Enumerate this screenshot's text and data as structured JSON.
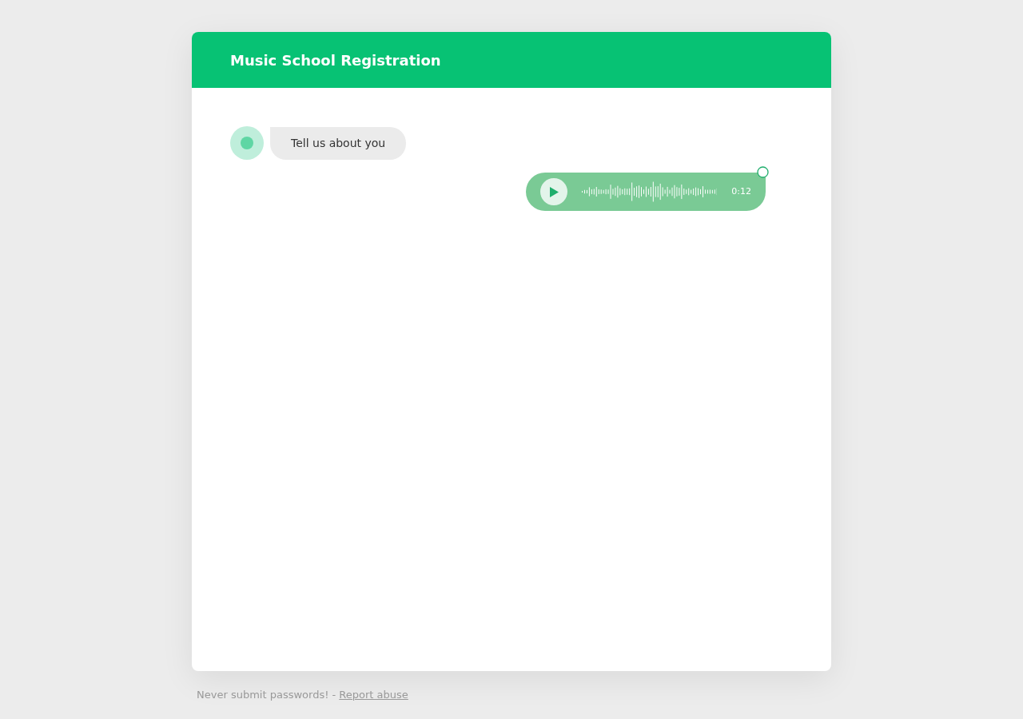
{
  "header": {
    "title": "Music School Registration"
  },
  "messages": [
    {
      "kind": "text",
      "text": "Tell us about you"
    },
    {
      "kind": "audio",
      "duration": "0:12"
    }
  ],
  "footer": {
    "note": "Never submit passwords! - ",
    "link": "Report abuse"
  }
}
